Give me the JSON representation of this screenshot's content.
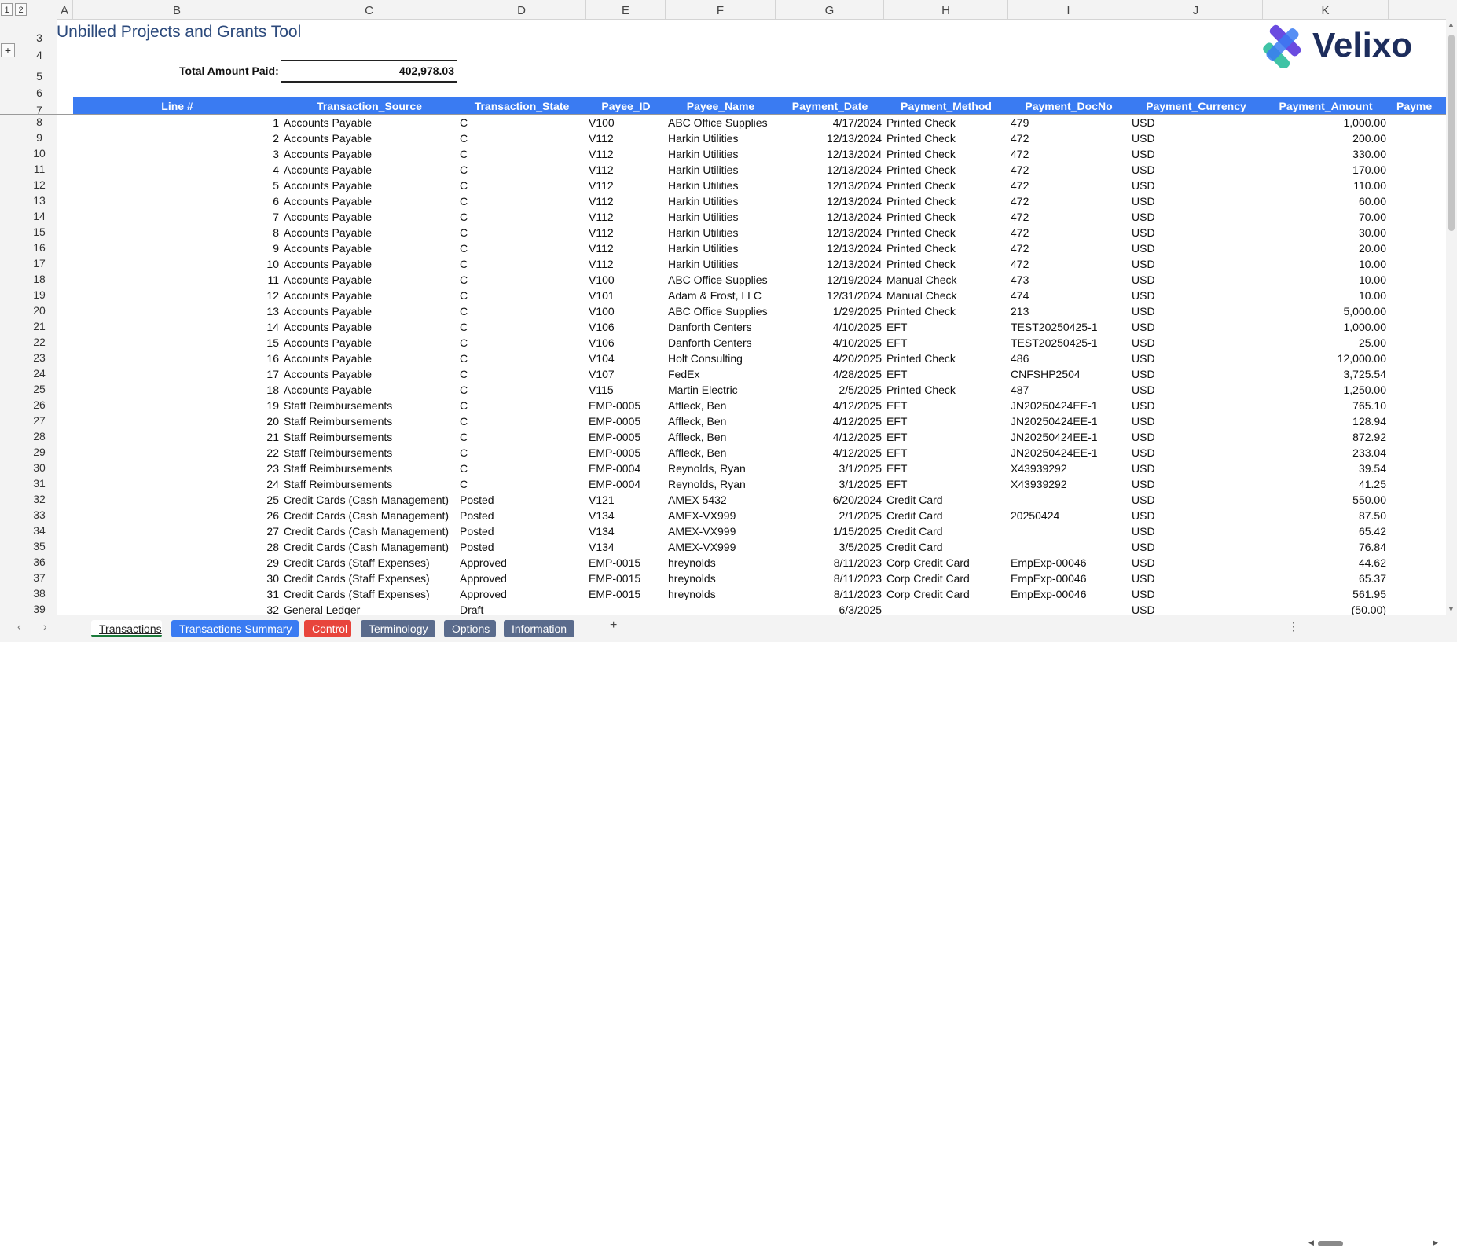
{
  "app": {
    "title": "Unbilled Projects and Grants Tool"
  },
  "logo": {
    "text": "Velixo"
  },
  "outline": {
    "level_buttons": [
      "1",
      "2"
    ],
    "expand": "+"
  },
  "columns": [
    "A",
    "B",
    "C",
    "D",
    "E",
    "F",
    "G",
    "H",
    "I",
    "J",
    "K"
  ],
  "row_numbers": [
    "3",
    "4",
    "5",
    "6",
    "7",
    "8",
    "9",
    "10",
    "11",
    "12",
    "13",
    "14",
    "15",
    "16",
    "17",
    "18",
    "19",
    "20",
    "21",
    "22",
    "23",
    "24",
    "25",
    "26",
    "27",
    "28",
    "29",
    "30",
    "31",
    "32",
    "33",
    "34",
    "35",
    "36",
    "37",
    "38",
    "39"
  ],
  "summary": {
    "label": "Total Amount Paid:",
    "value": "402,978.03"
  },
  "table": {
    "headers": [
      "Line #",
      "Transaction_Source",
      "Transaction_State",
      "Payee_ID",
      "Payee_Name",
      "Payment_Date",
      "Payment_Method",
      "Payment_DocNo",
      "Payment_Currency",
      "Payment_Amount",
      "Payme"
    ],
    "rows": [
      [
        "1",
        "Accounts Payable",
        "C",
        "V100",
        "ABC Office Supplies",
        "4/17/2024",
        "Printed Check",
        "479",
        "USD",
        "1,000.00"
      ],
      [
        "2",
        "Accounts Payable",
        "C",
        "V112",
        "Harkin Utilities",
        "12/13/2024",
        "Printed Check",
        "472",
        "USD",
        "200.00"
      ],
      [
        "3",
        "Accounts Payable",
        "C",
        "V112",
        "Harkin Utilities",
        "12/13/2024",
        "Printed Check",
        "472",
        "USD",
        "330.00"
      ],
      [
        "4",
        "Accounts Payable",
        "C",
        "V112",
        "Harkin Utilities",
        "12/13/2024",
        "Printed Check",
        "472",
        "USD",
        "170.00"
      ],
      [
        "5",
        "Accounts Payable",
        "C",
        "V112",
        "Harkin Utilities",
        "12/13/2024",
        "Printed Check",
        "472",
        "USD",
        "110.00"
      ],
      [
        "6",
        "Accounts Payable",
        "C",
        "V112",
        "Harkin Utilities",
        "12/13/2024",
        "Printed Check",
        "472",
        "USD",
        "60.00"
      ],
      [
        "7",
        "Accounts Payable",
        "C",
        "V112",
        "Harkin Utilities",
        "12/13/2024",
        "Printed Check",
        "472",
        "USD",
        "70.00"
      ],
      [
        "8",
        "Accounts Payable",
        "C",
        "V112",
        "Harkin Utilities",
        "12/13/2024",
        "Printed Check",
        "472",
        "USD",
        "30.00"
      ],
      [
        "9",
        "Accounts Payable",
        "C",
        "V112",
        "Harkin Utilities",
        "12/13/2024",
        "Printed Check",
        "472",
        "USD",
        "20.00"
      ],
      [
        "10",
        "Accounts Payable",
        "C",
        "V112",
        "Harkin Utilities",
        "12/13/2024",
        "Printed Check",
        "472",
        "USD",
        "10.00"
      ],
      [
        "11",
        "Accounts Payable",
        "C",
        "V100",
        "ABC Office Supplies",
        "12/19/2024",
        "Manual Check",
        "473",
        "USD",
        "10.00"
      ],
      [
        "12",
        "Accounts Payable",
        "C",
        "V101",
        "Adam & Frost, LLC",
        "12/31/2024",
        "Manual Check",
        "474",
        "USD",
        "10.00"
      ],
      [
        "13",
        "Accounts Payable",
        "C",
        "V100",
        "ABC Office Supplies",
        "1/29/2025",
        "Printed Check",
        "213",
        "USD",
        "5,000.00"
      ],
      [
        "14",
        "Accounts Payable",
        "C",
        "V106",
        "Danforth Centers",
        "4/10/2025",
        "EFT",
        "TEST20250425-1",
        "USD",
        "1,000.00"
      ],
      [
        "15",
        "Accounts Payable",
        "C",
        "V106",
        "Danforth Centers",
        "4/10/2025",
        "EFT",
        "TEST20250425-1",
        "USD",
        "25.00"
      ],
      [
        "16",
        "Accounts Payable",
        "C",
        "V104",
        "Holt Consulting",
        "4/20/2025",
        "Printed Check",
        "486",
        "USD",
        "12,000.00"
      ],
      [
        "17",
        "Accounts Payable",
        "C",
        "V107",
        "FedEx",
        "4/28/2025",
        "EFT",
        "CNFSHP2504",
        "USD",
        "3,725.54"
      ],
      [
        "18",
        "Accounts Payable",
        "C",
        "V115",
        "Martin Electric",
        "2/5/2025",
        "Printed Check",
        "487",
        "USD",
        "1,250.00"
      ],
      [
        "19",
        "Staff Reimbursements",
        "C",
        "EMP-0005",
        "Affleck, Ben",
        "4/12/2025",
        "EFT",
        "JN20250424EE-1",
        "USD",
        "765.10"
      ],
      [
        "20",
        "Staff Reimbursements",
        "C",
        "EMP-0005",
        "Affleck, Ben",
        "4/12/2025",
        "EFT",
        "JN20250424EE-1",
        "USD",
        "128.94"
      ],
      [
        "21",
        "Staff Reimbursements",
        "C",
        "EMP-0005",
        "Affleck, Ben",
        "4/12/2025",
        "EFT",
        "JN20250424EE-1",
        "USD",
        "872.92"
      ],
      [
        "22",
        "Staff Reimbursements",
        "C",
        "EMP-0005",
        "Affleck, Ben",
        "4/12/2025",
        "EFT",
        "JN20250424EE-1",
        "USD",
        "233.04"
      ],
      [
        "23",
        "Staff Reimbursements",
        "C",
        "EMP-0004",
        "Reynolds, Ryan",
        "3/1/2025",
        "EFT",
        "X43939292",
        "USD",
        "39.54"
      ],
      [
        "24",
        "Staff Reimbursements",
        "C",
        "EMP-0004",
        "Reynolds, Ryan",
        "3/1/2025",
        "EFT",
        "X43939292",
        "USD",
        "41.25"
      ],
      [
        "25",
        "Credit Cards (Cash Management)",
        "Posted",
        "V121",
        "AMEX 5432",
        "6/20/2024",
        "Credit Card",
        "",
        "USD",
        "550.00"
      ],
      [
        "26",
        "Credit Cards (Cash Management)",
        "Posted",
        "V134",
        "AMEX-VX999",
        "2/1/2025",
        "Credit Card",
        "20250424",
        "USD",
        "87.50"
      ],
      [
        "27",
        "Credit Cards (Cash Management)",
        "Posted",
        "V134",
        "AMEX-VX999",
        "1/15/2025",
        "Credit Card",
        "",
        "USD",
        "65.42"
      ],
      [
        "28",
        "Credit Cards (Cash Management)",
        "Posted",
        "V134",
        "AMEX-VX999",
        "3/5/2025",
        "Credit Card",
        "",
        "USD",
        "76.84"
      ],
      [
        "29",
        "Credit Cards (Staff Expenses)",
        "Approved",
        "EMP-0015",
        "hreynolds",
        "8/11/2023",
        "Corp Credit Card",
        "EmpExp-00046",
        "USD",
        "44.62"
      ],
      [
        "30",
        "Credit Cards (Staff Expenses)",
        "Approved",
        "EMP-0015",
        "hreynolds",
        "8/11/2023",
        "Corp Credit Card",
        "EmpExp-00046",
        "USD",
        "65.37"
      ],
      [
        "31",
        "Credit Cards (Staff Expenses)",
        "Approved",
        "EMP-0015",
        "hreynolds",
        "8/11/2023",
        "Corp Credit Card",
        "EmpExp-00046",
        "USD",
        "561.95"
      ],
      [
        "32",
        "General Ledger",
        "Draft",
        "",
        "",
        "6/3/2025",
        "",
        "",
        "USD",
        "(50.00)"
      ]
    ]
  },
  "sheet_tabs": [
    {
      "label": "Transactions",
      "color": "#f3f3f3",
      "text_color": "#1a5c2a",
      "active": true
    },
    {
      "label": "Transactions Summary",
      "color": "#3a7bf2",
      "text_color": "#ffffff"
    },
    {
      "label": "Control",
      "color": "#e8453c",
      "text_color": "#ffffff"
    },
    {
      "label": "Terminology",
      "color": "#5a6b8c",
      "text_color": "#ffffff"
    },
    {
      "label": "Options",
      "color": "#5a6b8c",
      "text_color": "#ffffff"
    },
    {
      "label": "Information",
      "color": "#5a6b8c",
      "text_color": "#ffffff"
    }
  ],
  "tabbar_icons": {
    "prev": "chevron-left-icon",
    "next": "chevron-right-icon",
    "add": "plus-icon",
    "more": "more-vertical-icon"
  },
  "colors": {
    "header_fill": "#3a7bf2",
    "title": "#2c4a7c"
  }
}
